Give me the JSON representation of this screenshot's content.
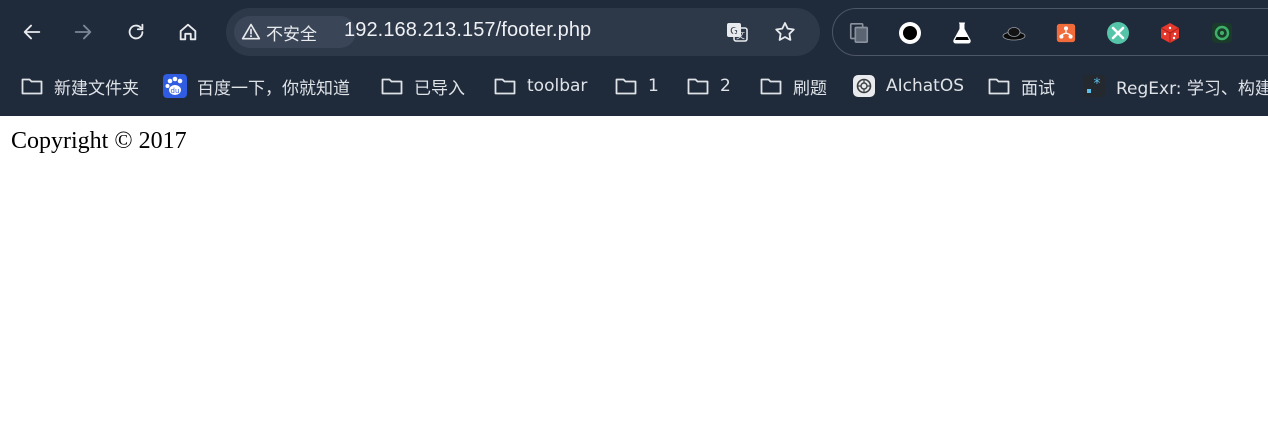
{
  "toolbar": {
    "back_icon": "arrow-left-icon",
    "forward_icon": "arrow-right-icon",
    "reload_icon": "reload-icon",
    "home_icon": "home-icon"
  },
  "omnibox": {
    "security_label": "不安全",
    "security_icon": "warning-triangle-icon",
    "url": "192.168.213.157/footer.php",
    "translate_icon": "translate-icon",
    "bookmark_icon": "star-icon"
  },
  "extensions": [
    {
      "icon": "copy-pages-extension-icon"
    },
    {
      "icon": "black-circle-extension-icon"
    },
    {
      "icon": "flask-extension-icon"
    },
    {
      "icon": "hat-extension-icon"
    },
    {
      "icon": "network-extension-icon"
    },
    {
      "icon": "tools-extension-icon"
    },
    {
      "icon": "dice-extension-icon"
    },
    {
      "icon": "green-gear-extension-icon"
    }
  ],
  "bookmarks": [
    {
      "label": "新建文件夹",
      "icon": "folder-icon"
    },
    {
      "label": "百度一下，你就知道",
      "icon": "baidu-icon"
    },
    {
      "label": "已导入",
      "icon": "folder-icon"
    },
    {
      "label": "toolbar",
      "icon": "folder-icon"
    },
    {
      "label": "1",
      "icon": "folder-icon"
    },
    {
      "label": "2",
      "icon": "folder-icon"
    },
    {
      "label": "刷题",
      "icon": "folder-icon"
    },
    {
      "label": "AIchatOS",
      "icon": "chatgpt-icon"
    },
    {
      "label": "面试",
      "icon": "folder-icon"
    },
    {
      "label": "RegExr: 学习、构建…",
      "icon": "regexr-icon"
    }
  ],
  "page": {
    "copyright": "Copyright © 2017"
  },
  "colors": {
    "chrome_bg": "#1f2a3a",
    "omnibox_bg": "#2d3848",
    "text_light": "#e8eaed",
    "page_bg": "#ffffff"
  }
}
